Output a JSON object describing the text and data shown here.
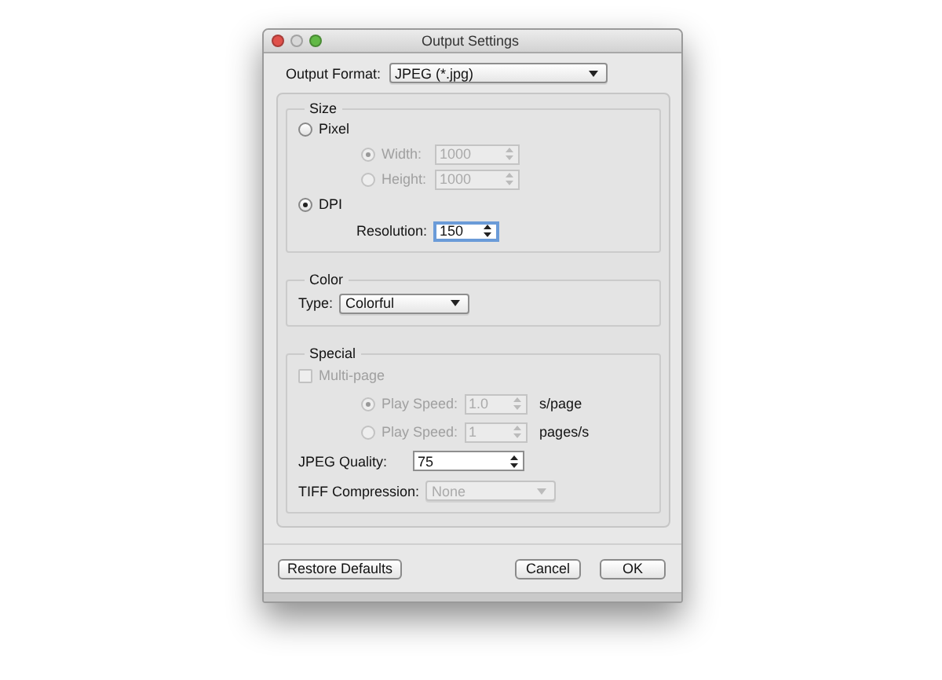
{
  "window": {
    "title": "Output Settings"
  },
  "output_format": {
    "label": "Output Format:",
    "value": "JPEG (*.jpg)"
  },
  "groups": [
    {
      "title": "Size",
      "rows": [
        {
          "kind": "radio",
          "label": "Pixel",
          "selected": false
        },
        {
          "kind": "subradio",
          "label": "Width:",
          "value": "1000",
          "selected": true,
          "disabled": true
        },
        {
          "kind": "subradio",
          "label": "Height:",
          "value": "1000",
          "selected": false,
          "disabled": true
        },
        {
          "kind": "radio",
          "label": "DPI",
          "selected": true
        },
        {
          "kind": "substepper",
          "label": "Resolution:",
          "value": "150",
          "disabled": false
        }
      ]
    },
    {
      "title": "Color",
      "rows": [
        {
          "kind": "popup",
          "label": "Type:",
          "value": "Colorful",
          "disabled": false
        }
      ]
    },
    {
      "title": "Special",
      "rows": [
        {
          "kind": "checkbox",
          "label": "Multi-page",
          "checked": false,
          "disabled": true
        },
        {
          "kind": "subradio",
          "label": "Play Speed:",
          "value": "1.0",
          "unit": "s/page",
          "selected": true,
          "disabled": true
        },
        {
          "kind": "subradio",
          "label": "Play Speed:",
          "value": "1",
          "unit": "pages/s",
          "selected": false,
          "disabled": true
        },
        {
          "kind": "stepper-row",
          "label": "JPEG Quality:",
          "value": "75",
          "disabled": false
        },
        {
          "kind": "popup-row",
          "label": "TIFF Compression:",
          "value": "None",
          "disabled": true
        }
      ]
    }
  ],
  "left_buttons": [
    {
      "label": "Restore Defaults"
    }
  ],
  "right_buttons": [
    {
      "label": "Cancel"
    },
    {
      "label": "OK"
    }
  ]
}
